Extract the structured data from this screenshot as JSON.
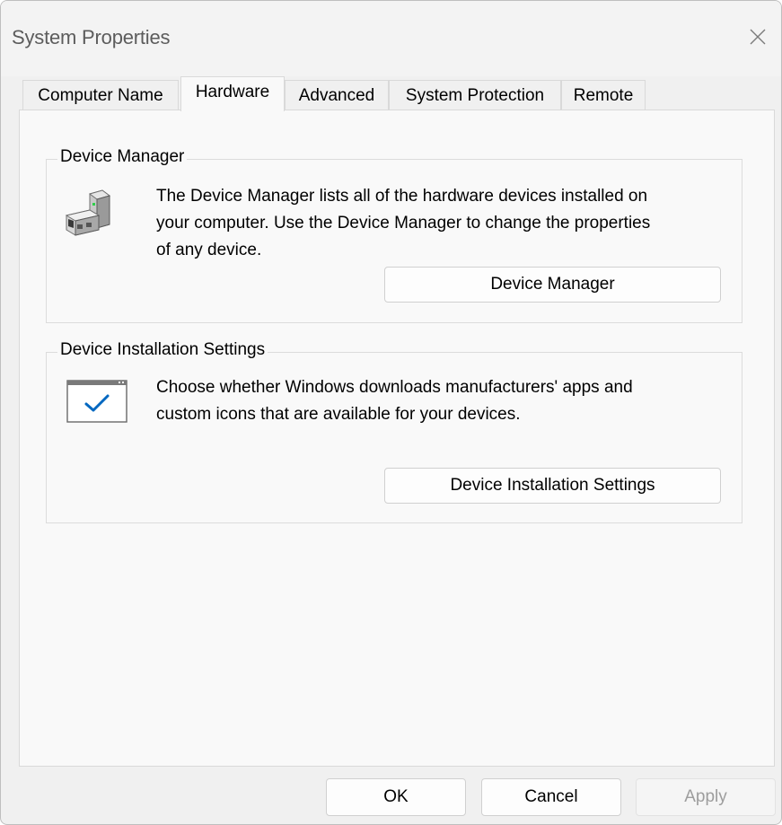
{
  "window": {
    "title": "System Properties"
  },
  "tabs": [
    {
      "label": "Computer Name",
      "selected": false
    },
    {
      "label": "Hardware",
      "selected": true
    },
    {
      "label": "Advanced",
      "selected": false
    },
    {
      "label": "System Protection",
      "selected": false
    },
    {
      "label": "Remote",
      "selected": false
    }
  ],
  "device_manager": {
    "heading": "Device Manager",
    "description_line1": "The Device Manager lists all of the hardware devices installed on",
    "description_line2": "your computer. Use the Device Manager to change the properties",
    "description_line3": "of any device.",
    "button_label": "Device Manager",
    "icon": "device-manager-icon"
  },
  "device_installation": {
    "heading": "Device Installation Settings",
    "description_line1": "Choose whether Windows downloads manufacturers' apps and",
    "description_line2": "custom icons that are available for your devices.",
    "button_label": "Device Installation Settings",
    "icon": "checkmark-window-icon"
  },
  "footer": {
    "ok_label": "OK",
    "cancel_label": "Cancel",
    "apply_label": "Apply",
    "apply_enabled": false
  },
  "colors": {
    "accent": "#0067c0",
    "window_bg": "#f0f0f0",
    "panel_bg": "#f9f9f9"
  }
}
